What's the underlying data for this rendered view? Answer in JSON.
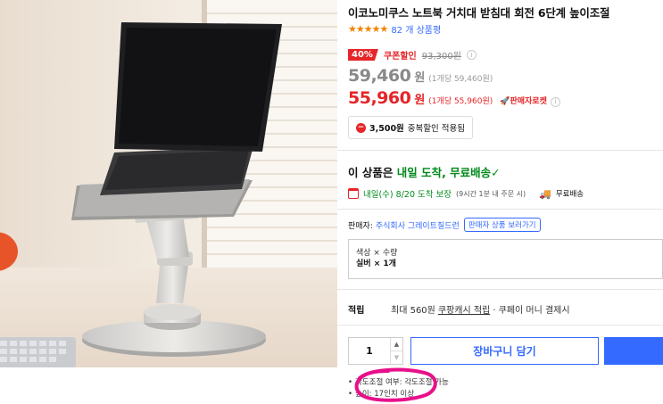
{
  "product": {
    "title": "이코노미쿠스 노트북 거치대 받침대 회전 6단계 높이조절",
    "stars": "★★★★★",
    "review_count": "82 개 상품평",
    "rating_fraction": 0.9
  },
  "pricing": {
    "discount_pct": "40%",
    "coupon_label": "쿠폰할인",
    "original_price": "93,300원",
    "price_regular": "59,460",
    "price_regular_unit": "원",
    "price_regular_per": "(1개당 59,460원)",
    "price_coupon": "55,960",
    "price_coupon_unit": "원",
    "price_coupon_per": "(1개당 55,960원)",
    "lowest_badge": "판매자로켓",
    "duplicate_amount": "3,500원",
    "duplicate_text": "중복할인 적용됨"
  },
  "delivery": {
    "head_prefix": "이 상품은 ",
    "head_green": "내일 도착, 무료배송",
    "check": "✓",
    "date_green": "내일(수) 8/20 도착 보장",
    "date_note": "(9시간 1분 내 주문 시)",
    "free_label": "무료배송"
  },
  "seller": {
    "label": "판매자:",
    "name": "주식회사 그레이트칠드런",
    "button": "판매자 상품 보러가기"
  },
  "option": {
    "line1": "색상 × 수량",
    "line2": "실버 × 1개"
  },
  "reward": {
    "label": "적립",
    "text1": "최대 560원",
    "link": "쿠팡캐시 적립",
    "text2": "· 쿠페이 머니 결제시"
  },
  "purchase": {
    "quantity": "1",
    "up_arrow": "▲",
    "down_arrow": "▼",
    "cart_label": "장바구니 담기"
  },
  "specs": [
    "각도조절 여부: 각도조절 가능",
    "높이: 17인치 이상"
  ],
  "colors": {
    "accent_blue": "#346aff",
    "price_red": "#e52528",
    "delivery_green": "#00891a",
    "annotation_magenta": "#e8108a"
  }
}
